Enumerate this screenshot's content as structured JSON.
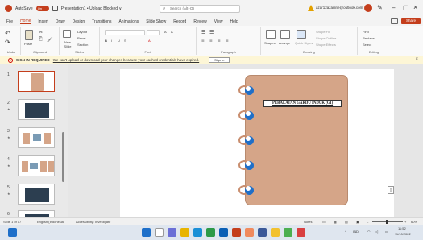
{
  "titlebar": {
    "autosave_label": "AutoSave",
    "autosave_state": "On",
    "doc_title": "Presentation1 • Upload Blocked ∨",
    "search_placeholder": "Search (Alt+Q)",
    "account": "azar12azarline@outlook.com"
  },
  "menu_tabs": [
    "File",
    "Home",
    "Insert",
    "Draw",
    "Design",
    "Transitions",
    "Animations",
    "Slide Show",
    "Record",
    "Review",
    "View",
    "Help"
  ],
  "active_tab": "Home",
  "share_label": "Share",
  "ribbon": {
    "groups": [
      "Undo",
      "Clipboard",
      "Slides",
      "Font",
      "Paragraph",
      "Drawing",
      "Editing"
    ],
    "buttons": {
      "paste": "Paste",
      "new_slide": "New Slide",
      "layout": "Layout",
      "reset": "Reset",
      "section": "Section",
      "shapes": "Shapes",
      "arrange": "Arrange",
      "quick_styles": "Quick Styles",
      "shape_fill": "Shape Fill",
      "shape_outline": "Shape Outline",
      "shape_effects": "Shape Effects",
      "find": "Find",
      "replace": "Replace",
      "select": "Select"
    }
  },
  "notification": {
    "bold": "SIGN IN REQUIRED",
    "text": "We can't upload or download your changes because your cached credentials have expired.",
    "button": "Sign in"
  },
  "thumbnails": [
    {
      "num": "1",
      "kind": "notebook"
    },
    {
      "num": "2",
      "kind": "dark"
    },
    {
      "num": "3",
      "kind": "cards"
    },
    {
      "num": "4",
      "kind": "cards"
    },
    {
      "num": "5",
      "kind": "dark"
    },
    {
      "num": "6",
      "kind": "dark"
    }
  ],
  "slide": {
    "title": "PERALATAN GARDU INDUK (GI)",
    "ring_count": 5
  },
  "statusbar": {
    "slide_info": "Slide 1 of 17",
    "language": "English (Indonesia)",
    "accessibility": "Accessibility: Investigate",
    "notes": "Notes",
    "zoom": "60%"
  },
  "taskbar": {
    "tray_lang": "IND",
    "time": "11:52",
    "date": "11/10/2022"
  },
  "colors": {
    "accent": "#c43e1c",
    "notebook": "#d5a588",
    "ring_blue": "#1e6fc9"
  }
}
